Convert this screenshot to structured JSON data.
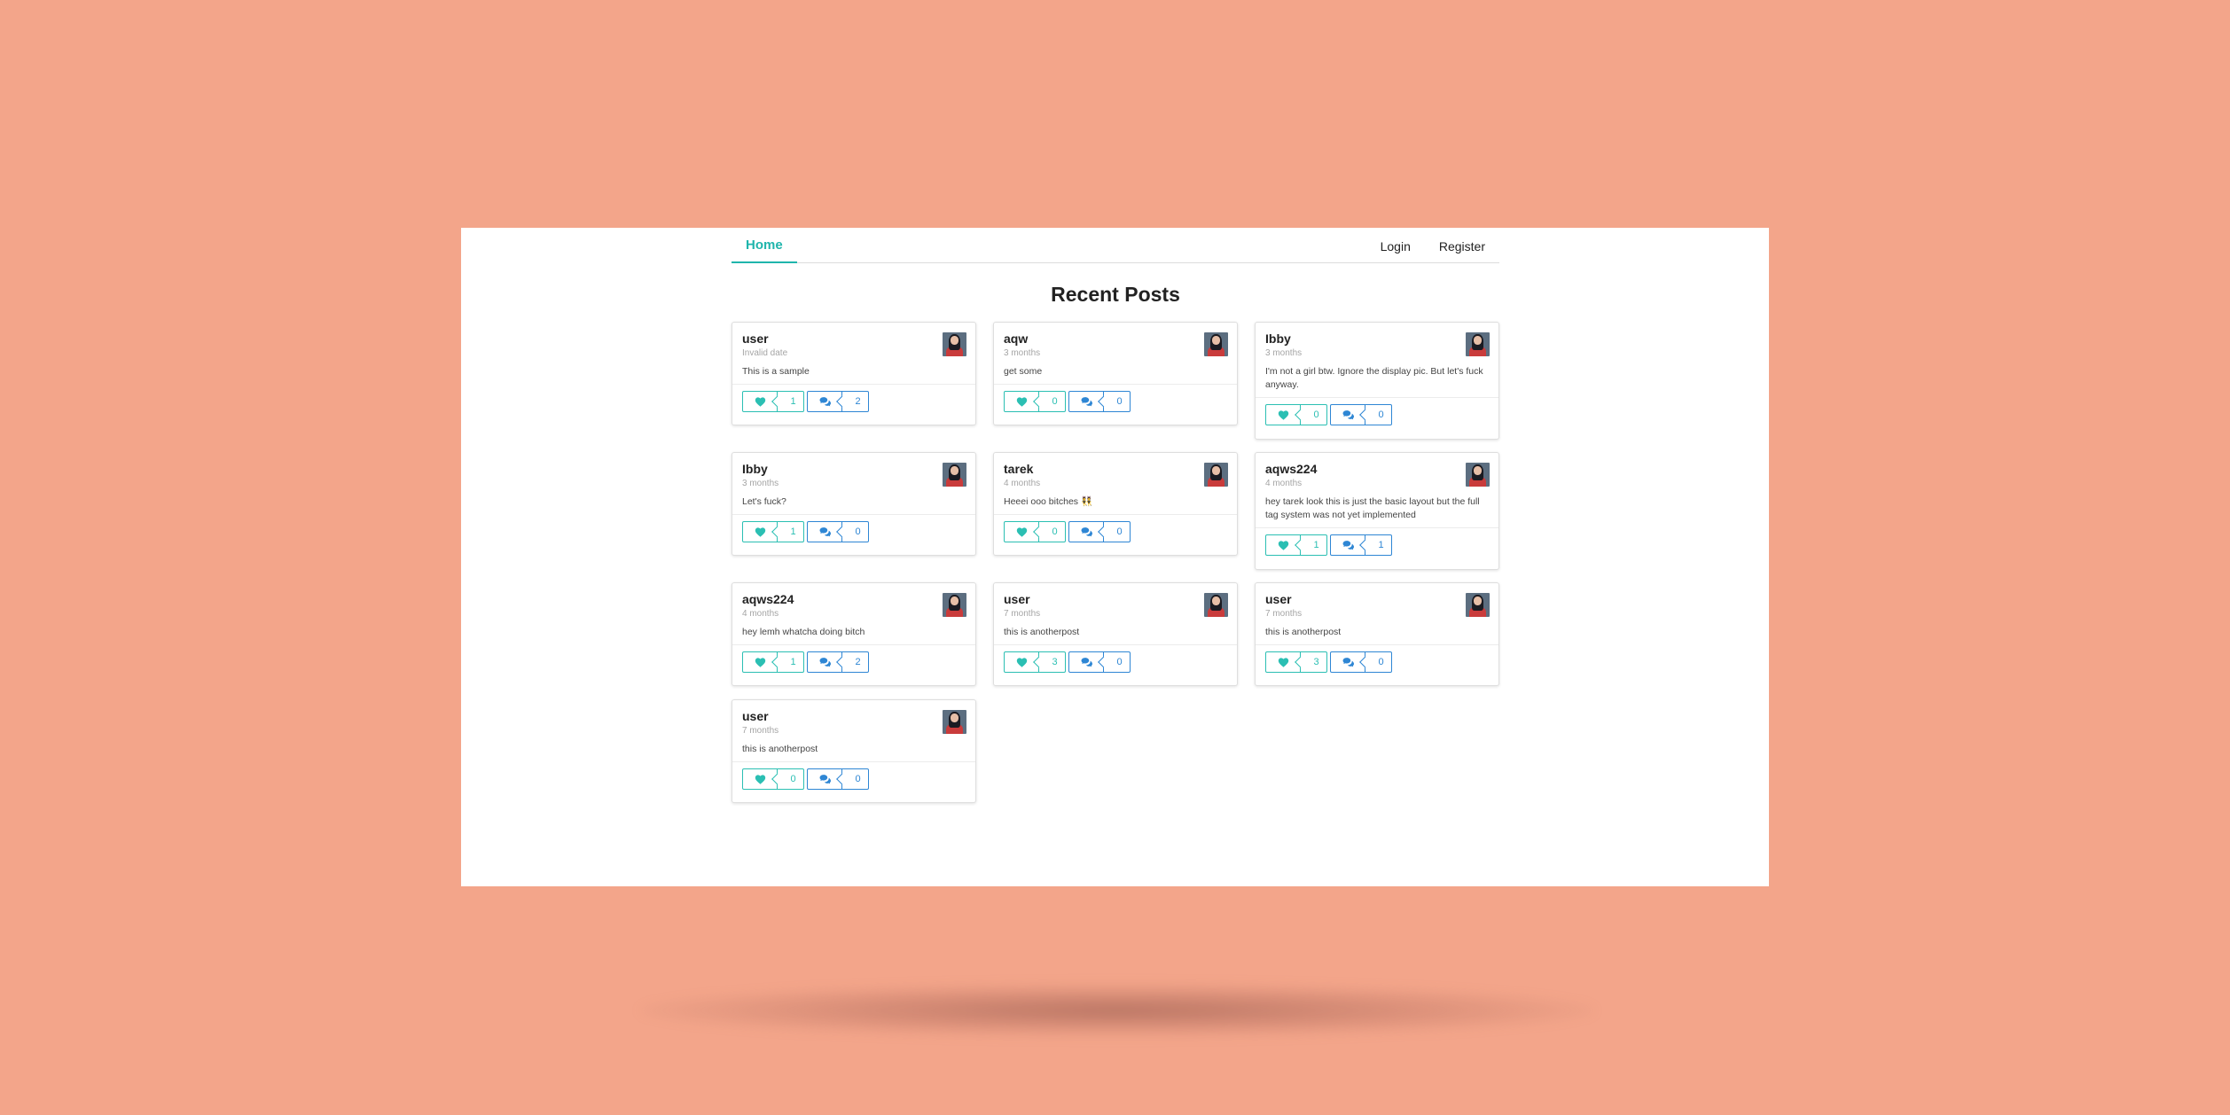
{
  "nav": {
    "home_label": "Home",
    "login_label": "Login",
    "register_label": "Register"
  },
  "page": {
    "title": "Recent Posts"
  },
  "colors": {
    "background": "#f3a58a",
    "accent_teal": "#2bbfb3",
    "accent_blue": "#2e86d4"
  },
  "icons": {
    "like": "heart-icon",
    "comment": "comment-icon",
    "avatar": "user-avatar"
  },
  "posts": [
    {
      "author": "user",
      "time": "Invalid date",
      "content": "This is a sample",
      "likes": "1",
      "comments": "2"
    },
    {
      "author": "aqw",
      "time": "3 months",
      "content": "get some",
      "likes": "0",
      "comments": "0"
    },
    {
      "author": "Ibby",
      "time": "3 months",
      "content": "I'm not a girl btw. Ignore the display pic. But let's fuck anyway.",
      "likes": "0",
      "comments": "0"
    },
    {
      "author": "Ibby",
      "time": "3 months",
      "content": "Let's fuck?",
      "likes": "1",
      "comments": "0"
    },
    {
      "author": "tarek",
      "time": "4 months",
      "content": "Heeei ooo bitches 👯",
      "likes": "0",
      "comments": "0"
    },
    {
      "author": "aqws224",
      "time": "4 months",
      "content": "hey tarek look this is just the basic layout but the full tag system was not yet implemented",
      "likes": "1",
      "comments": "1"
    },
    {
      "author": "aqws224",
      "time": "4 months",
      "content": "hey lemh whatcha doing bitch",
      "likes": "1",
      "comments": "2"
    },
    {
      "author": "user",
      "time": "7 months",
      "content": "this is anotherpost",
      "likes": "3",
      "comments": "0"
    },
    {
      "author": "user",
      "time": "7 months",
      "content": "this is anotherpost",
      "likes": "3",
      "comments": "0"
    },
    {
      "author": "user",
      "time": "7 months",
      "content": "this is anotherpost",
      "likes": "0",
      "comments": "0"
    }
  ]
}
